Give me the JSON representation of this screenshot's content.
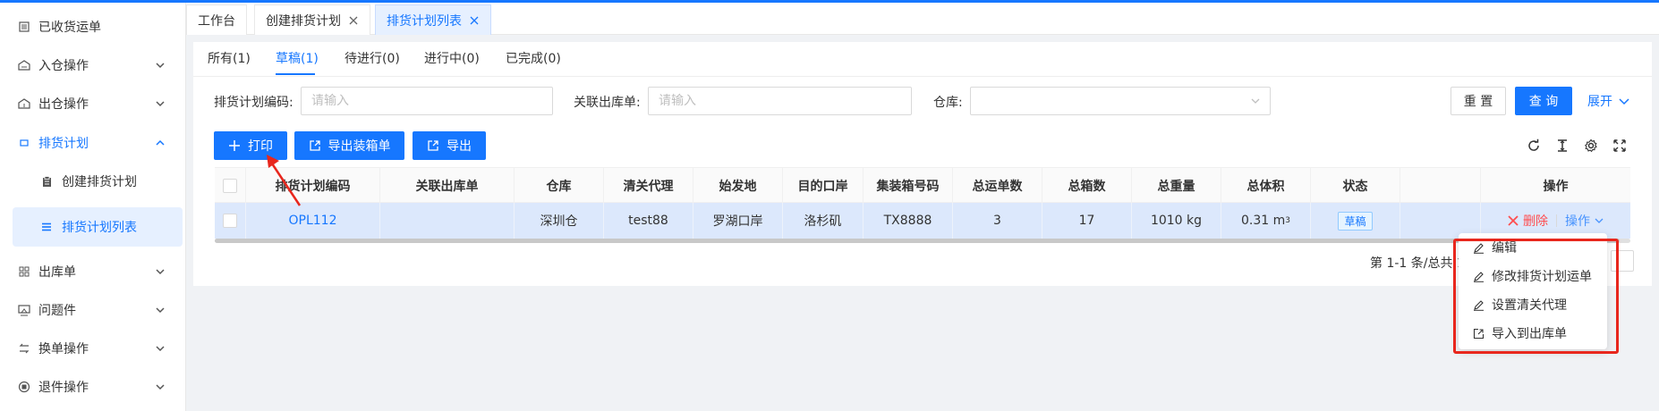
{
  "sidebar": {
    "items": [
      {
        "label": "已收货运单",
        "icon": "list-icon"
      },
      {
        "label": "入仓操作",
        "icon": "warehouse-in-icon"
      },
      {
        "label": "出仓操作",
        "icon": "warehouse-out-icon"
      },
      {
        "label": "排货计划",
        "icon": "plan-icon"
      },
      {
        "label": "创建排货计划",
        "icon": "clipboard-icon"
      },
      {
        "label": "排货计划列表",
        "icon": "menu-list-icon"
      },
      {
        "label": "出库单",
        "icon": "grid-icon"
      },
      {
        "label": "问题件",
        "icon": "monitor-icon"
      },
      {
        "label": "换单操作",
        "icon": "exchange-icon"
      },
      {
        "label": "退件操作",
        "icon": "return-icon"
      }
    ]
  },
  "page_tabs": [
    {
      "label": "工作台"
    },
    {
      "label": "创建排货计划"
    },
    {
      "label": "排货计划列表"
    }
  ],
  "status_tabs": [
    {
      "label": "所有(1)"
    },
    {
      "label": "草稿(1)"
    },
    {
      "label": "待进行(0)"
    },
    {
      "label": "进行中(0)"
    },
    {
      "label": "已完成(0)"
    }
  ],
  "filters": {
    "plan_code_label": "排货计划编码:",
    "plan_code_placeholder": "请输入",
    "outbound_label": "关联出库单:",
    "outbound_placeholder": "请输入",
    "warehouse_label": "仓库:",
    "reset_label": "重 置",
    "query_label": "查 询",
    "expand_label": "展开"
  },
  "toolbar": {
    "print_label": "打印",
    "export_packing_label": "导出装箱单",
    "export_label": "导出"
  },
  "table": {
    "columns": [
      "排货计划编码",
      "关联出库单",
      "仓库",
      "清关代理",
      "始发地",
      "目的口岸",
      "集装箱号码",
      "总运单数",
      "总箱数",
      "总重量",
      "总体积",
      "状态",
      "",
      "操作"
    ],
    "rows": [
      {
        "code": "OPL112",
        "outbound": "",
        "warehouse": "深圳仓",
        "agent": "test88",
        "origin": "罗湖口岸",
        "destination": "洛杉矶",
        "container": "TX8888",
        "waybills": "3",
        "boxes": "17",
        "weight": "1010 kg",
        "volume_value": "0.31 m",
        "volume_sup": "3",
        "status": "草稿",
        "delete_label": "删除",
        "more_label": "操作"
      }
    ]
  },
  "pagination": {
    "summary": "第 1-1 条/总共 1"
  },
  "dropdown": {
    "items": [
      {
        "label": "编辑",
        "icon": "edit-icon"
      },
      {
        "label": "修改排货计划运单",
        "icon": "edit-icon"
      },
      {
        "label": "设置清关代理",
        "icon": "edit-icon"
      },
      {
        "label": "导入到出库单",
        "icon": "import-icon"
      }
    ]
  },
  "colors": {
    "primary": "#1677ff",
    "danger": "#ff4d4f",
    "highlight": "#e8271d"
  }
}
